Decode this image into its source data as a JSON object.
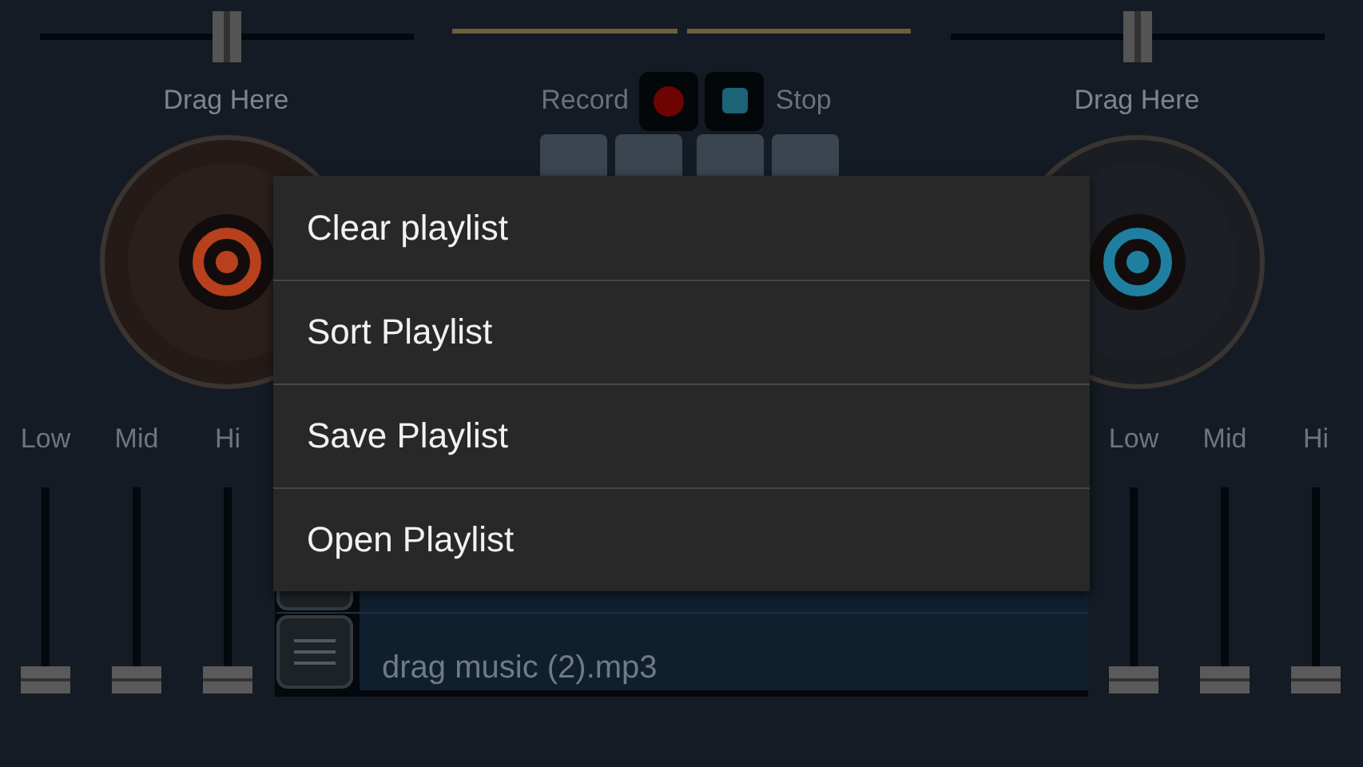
{
  "decks": [
    {
      "drag_label": "Drag Here",
      "color": "#b8401c",
      "pitch": {
        "level": 0.5
      },
      "eq": [
        {
          "label": "Low",
          "level": 0
        },
        {
          "label": "Mid",
          "level": 0
        },
        {
          "label": "Hi",
          "level": 0
        }
      ]
    },
    {
      "drag_label": "Drag Here",
      "color": "#1f7fa0",
      "pitch": {
        "level": 0.5
      },
      "eq": [
        {
          "label": "Low",
          "level": 0
        },
        {
          "label": "Mid",
          "level": 0
        },
        {
          "label": "Hi",
          "level": 0
        }
      ]
    }
  ],
  "recorder": {
    "record_label": "Record",
    "stop_label": "Stop"
  },
  "playlist": {
    "rows": [
      {
        "kind": "covered"
      },
      {
        "kind": "track",
        "title": "drag music (2).mp3"
      }
    ]
  },
  "menu": {
    "items": [
      "Clear playlist",
      "Sort Playlist",
      "Save Playlist",
      "Open Playlist"
    ]
  }
}
